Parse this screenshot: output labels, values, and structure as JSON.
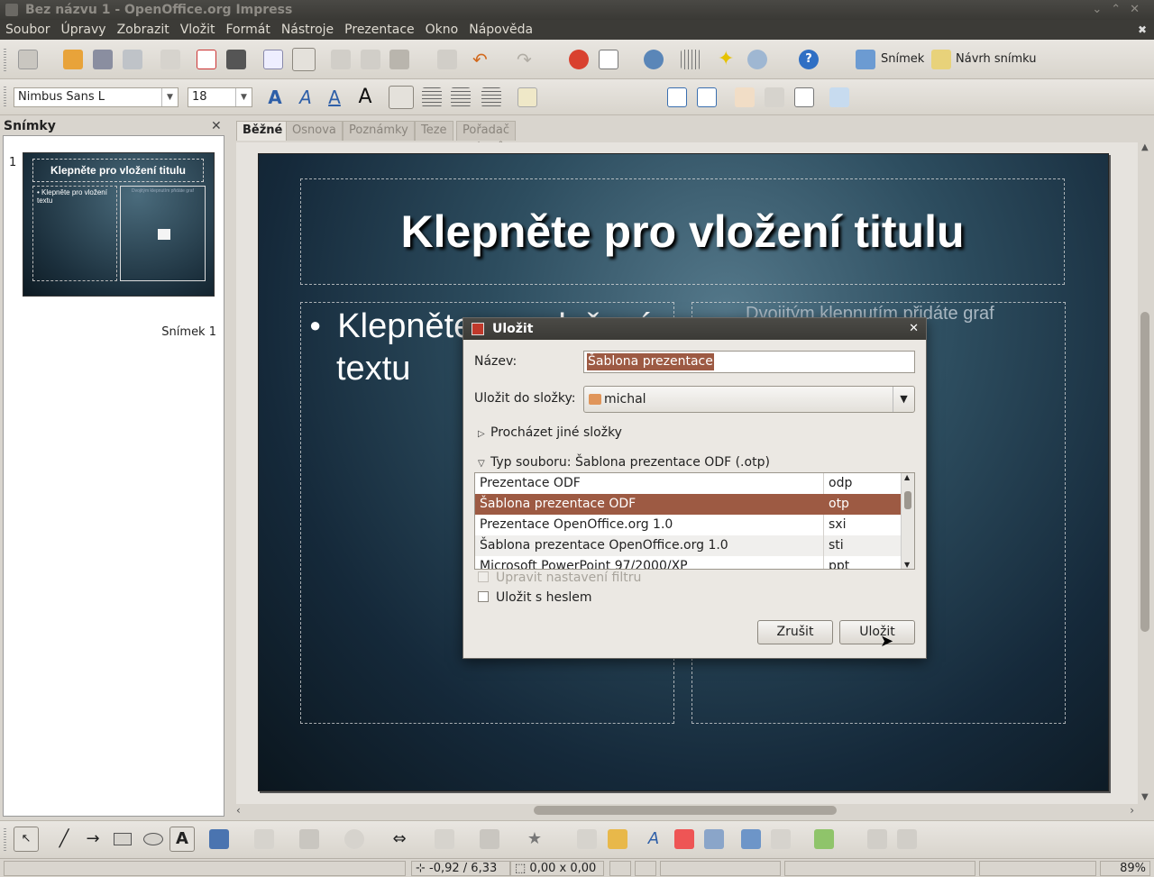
{
  "window": {
    "title": "Bez názvu 1 - OpenOffice.org Impress"
  },
  "menu": [
    "Soubor",
    "Úpravy",
    "Zobrazit",
    "Vložit",
    "Formát",
    "Nástroje",
    "Prezentace",
    "Okno",
    "Nápověda"
  ],
  "toolbar": {
    "slide_label": "Snímek",
    "layout_label": "Návrh snímku"
  },
  "format_toolbar": {
    "font_name": "Nimbus Sans L",
    "font_size": "18"
  },
  "slides_pane": {
    "title": "Snímky",
    "slide_number": "1",
    "slide_label": "Snímek 1",
    "thumb_title": "Klepněte pro vložení titulu",
    "thumb_text": "Klepněte pro vložení textu",
    "thumb_chart_text": "Dvojitým klepnutím přidáte graf"
  },
  "tabs": [
    "Běžné",
    "Osnova",
    "Poznámky",
    "Teze",
    "Pořadač snímků"
  ],
  "slide": {
    "title": "Klepněte pro vložení titulu",
    "body_line1": "Klepněte pro vložení",
    "body_line2": "textu",
    "chart_placeholder": "Dvojitým klepnutím přidáte graf"
  },
  "status": {
    "position": "-0,92 / 6,33",
    "size": "0,00 x 0,00",
    "zoom": "89%"
  },
  "dialog": {
    "title": "Uložit",
    "name_label": "Název:",
    "name_value": "Šablona prezentace",
    "folder_label": "Uložit do složky:",
    "folder_value": "michal",
    "browse_label": "Procházet jiné složky",
    "filetype_label": "Typ souboru: Šablona prezentace ODF (.otp)",
    "file_types": [
      {
        "name": "Prezentace ODF",
        "ext": "odp"
      },
      {
        "name": "Šablona prezentace ODF",
        "ext": "otp"
      },
      {
        "name": "Prezentace OpenOffice.org 1.0",
        "ext": "sxi"
      },
      {
        "name": "Šablona prezentace OpenOffice.org 1.0",
        "ext": "sti"
      },
      {
        "name": "Microsoft PowerPoint 97/2000/XP",
        "ext": "ppt"
      }
    ],
    "filter_settings_label": "Upravit nastavení filtru",
    "password_label": "Uložit s heslem",
    "cancel_label": "Zrušit",
    "save_label": "Uložit"
  }
}
